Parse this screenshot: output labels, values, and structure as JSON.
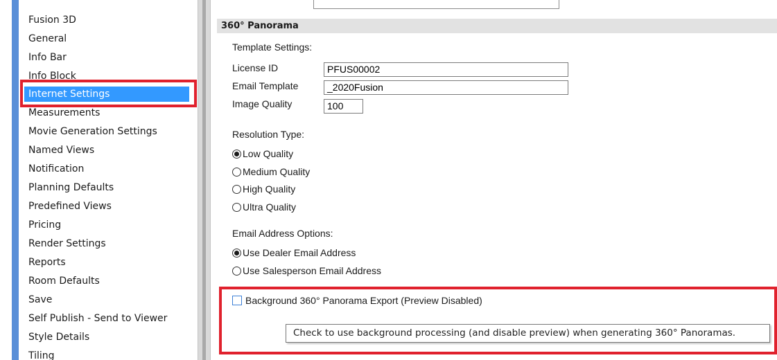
{
  "sidebar": {
    "items": [
      {
        "label": "Fusion 3D"
      },
      {
        "label": "General"
      },
      {
        "label": "Info Bar"
      },
      {
        "label": "Info Block"
      },
      {
        "label": "Internet Settings",
        "selected": true
      },
      {
        "label": "Measurements"
      },
      {
        "label": "Movie Generation Settings"
      },
      {
        "label": "Named Views"
      },
      {
        "label": "Notification"
      },
      {
        "label": "Planning Defaults"
      },
      {
        "label": "Predefined Views"
      },
      {
        "label": "Pricing"
      },
      {
        "label": "Render Settings"
      },
      {
        "label": "Reports"
      },
      {
        "label": "Room Defaults"
      },
      {
        "label": "Save"
      },
      {
        "label": "Self Publish - Send to Viewer"
      },
      {
        "label": "Style Details"
      },
      {
        "label": "Tiling"
      }
    ],
    "accent_color": "#3399ff"
  },
  "panel": {
    "section_title": "360° Panorama",
    "template_settings_label": "Template Settings:",
    "license_id_label": "License ID",
    "license_id_value": "PFUS00002",
    "email_template_label": "Email Template",
    "email_template_value": "_2020Fusion",
    "image_quality_label": "Image Quality",
    "image_quality_value": "100",
    "resolution_type_label": "Resolution Type:",
    "resolution_options": [
      {
        "label": "Low Quality",
        "checked": true
      },
      {
        "label": "Medium Quality",
        "checked": false
      },
      {
        "label": "High Quality",
        "checked": false
      },
      {
        "label": "Ultra Quality",
        "checked": false
      }
    ],
    "email_options_label": "Email Address Options:",
    "email_options": [
      {
        "label": "Use Dealer Email Address",
        "checked": true
      },
      {
        "label": "Use Salesperson Email Address",
        "checked": false
      }
    ],
    "background_export_label": "Background 360° Panorama Export (Preview Disabled)",
    "background_export_checked": false,
    "tooltip_text": "Check to use background processing (and disable preview) when generating 360° Panoramas.",
    "highlight_color": "#e0212d"
  }
}
